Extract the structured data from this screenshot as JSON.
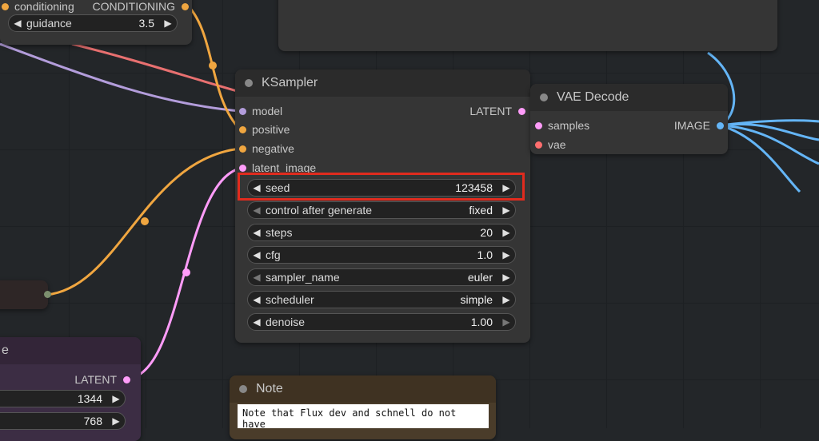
{
  "top_node": {
    "input_conditioning": "conditioning",
    "output_conditioning": "CONDITIONING",
    "guidance_label": "guidance",
    "guidance_value": "3.5"
  },
  "ksampler": {
    "title": "KSampler",
    "inputs": [
      "model",
      "positive",
      "negative",
      "latent_image"
    ],
    "output": "LATENT",
    "widgets": [
      {
        "label": "seed",
        "value": "123458"
      },
      {
        "label": "control after generate",
        "value": "fixed"
      },
      {
        "label": "steps",
        "value": "20"
      },
      {
        "label": "cfg",
        "value": "1.0"
      },
      {
        "label": "sampler_name",
        "value": "euler"
      },
      {
        "label": "scheduler",
        "value": "simple"
      },
      {
        "label": "denoise",
        "value": "1.00"
      }
    ]
  },
  "vae_decode": {
    "title": "VAE Decode",
    "inputs": [
      "samples",
      "vae"
    ],
    "output": "IMAGE"
  },
  "latent_node": {
    "title_fragment": "e",
    "output": "LATENT",
    "width_value": "1344",
    "height_value": "768"
  },
  "note": {
    "title": "Note",
    "text": "Note that Flux dev and schnell do not have"
  },
  "colors": {
    "model": "#b39ddb",
    "conditioning": "#f0a640",
    "latent": "#ff9cf9",
    "vae": "#ff6e6e",
    "image": "#64b5f6",
    "highlight": "#e12b1e"
  }
}
